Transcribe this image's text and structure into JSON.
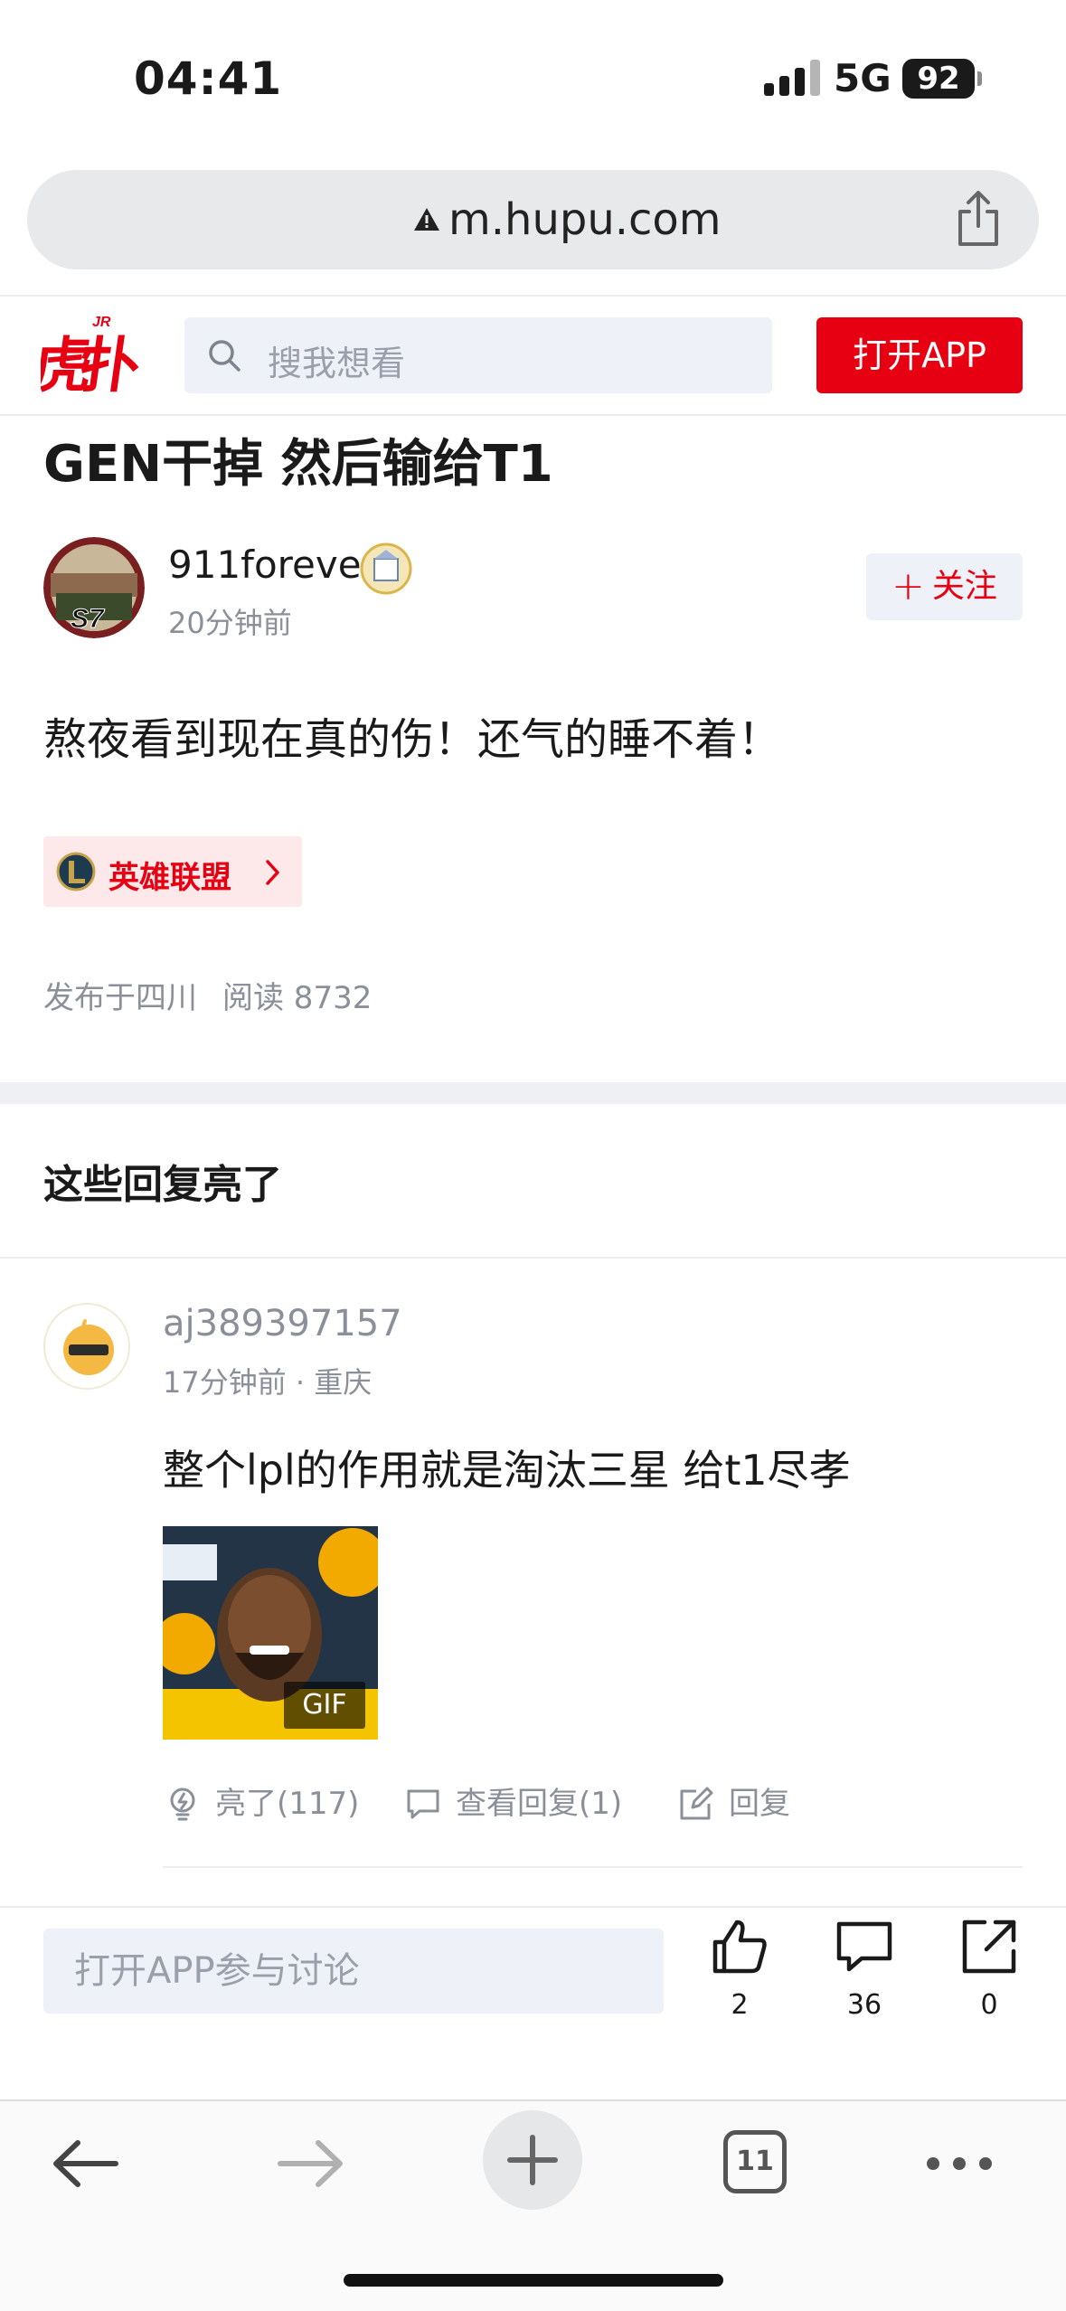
{
  "status_bar": {
    "time": "04:41",
    "network": "5G",
    "battery": "92"
  },
  "browser": {
    "url": "m.hupu.com",
    "tab_count": "11"
  },
  "header": {
    "search_placeholder": "搜我想看",
    "open_app": "打开APP",
    "logo_text": "虎扑",
    "logo_mark": "JR"
  },
  "post": {
    "title": "GEN干掉 然后输给T1",
    "author": {
      "name": "911forever",
      "time": "20分钟前"
    },
    "follow_label": "关注",
    "body": "熬夜看到现在真的伤！还气的睡不着！",
    "topic": "英雄联盟",
    "meta": {
      "location": "发布于四川",
      "reads": "阅读 8732"
    }
  },
  "replies_section": {
    "title": "这些回复亮了",
    "reply": {
      "user": "aj389397157",
      "meta": "17分钟前 · 重庆",
      "text": "整个lpl的作用就是淘汰三星 给t1尽孝",
      "gif_badge": "GIF",
      "light_label": "亮了(117)",
      "view_replies_label": "查看回复(1)",
      "reply_label": "回复"
    }
  },
  "bottom_bar": {
    "input_placeholder": "打开APP参与讨论",
    "likes": "2",
    "comments": "36",
    "shares": "0"
  },
  "colors": {
    "brand_red": "#e60012",
    "muted": "#8b8f99"
  }
}
